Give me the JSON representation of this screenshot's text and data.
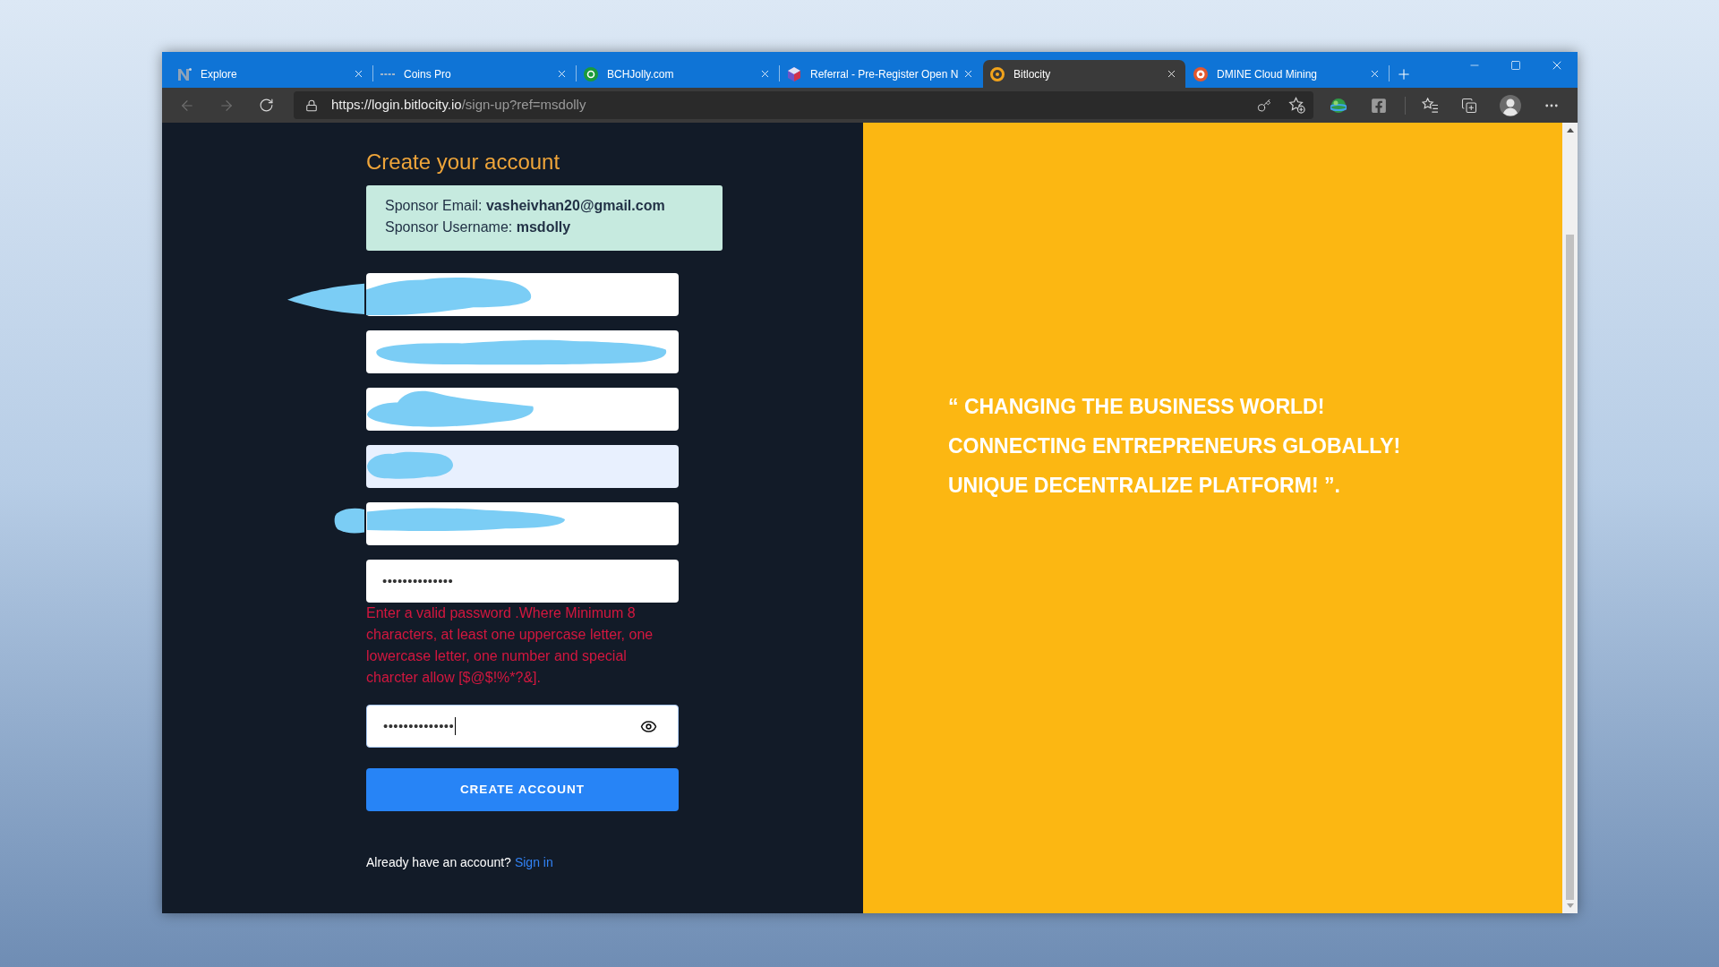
{
  "browser": {
    "tabs": [
      {
        "title": "Explore",
        "selected": false,
        "kind": "logo"
      },
      {
        "title": "Coins Pro",
        "selected": false,
        "kind": "dashes"
      },
      {
        "title": "BCHJolly.com",
        "selected": false,
        "kind": "coin"
      },
      {
        "title": "Referral - Pre-Register Open N",
        "selected": false,
        "kind": "cube"
      },
      {
        "title": "Bitlocity",
        "selected": true,
        "kind": "ring"
      },
      {
        "title": "DMINE Cloud Mining",
        "selected": false,
        "kind": "disc"
      }
    ],
    "address_bar": {
      "url_host": "https://login.bitlocity.io",
      "url_path": "/sign-up?ref=msdolly"
    }
  },
  "signup": {
    "title": "Create your account",
    "sponsor_lines": [
      "Sponsor Email: **vasheivhan20@gmail.com**",
      "Sponsor Username: **msdolly**"
    ],
    "fields": [
      {
        "redacted": true,
        "autofilled": false,
        "focused": false
      },
      {
        "redacted": true,
        "autofilled": false,
        "focused": false
      },
      {
        "redacted": true,
        "autofilled": false,
        "focused": false
      },
      {
        "redacted": true,
        "autofilled": true,
        "focused": false
      },
      {
        "redacted": true,
        "autofilled": false,
        "focused": false
      },
      {
        "redacted": false,
        "autofilled": false,
        "focused": false,
        "show_toggle": false,
        "value": "••••••••••••••",
        "error": "Enter a valid password .Where Minimum 8 characters, at least one uppercase letter, one lowercase letter, one number and special charcter allow [$@$!%*?&]."
      },
      {
        "redacted": false,
        "autofilled": false,
        "focused": true,
        "show_toggle": true,
        "value": "••••••••••••••"
      }
    ],
    "submit_button": "CREATE ACCOUNT",
    "signin_prompt": {
      "text": "Already have an account?",
      "link": "Sign in"
    }
  },
  "promo": {
    "quote_lines": [
      "“ CHANGING THE BUSINESS WORLD!",
      "CONNECTING ENTREPRENEURS GLOBALLY!",
      "UNIQUE DECENTRALIZE PLATFORM! ”."
    ]
  }
}
